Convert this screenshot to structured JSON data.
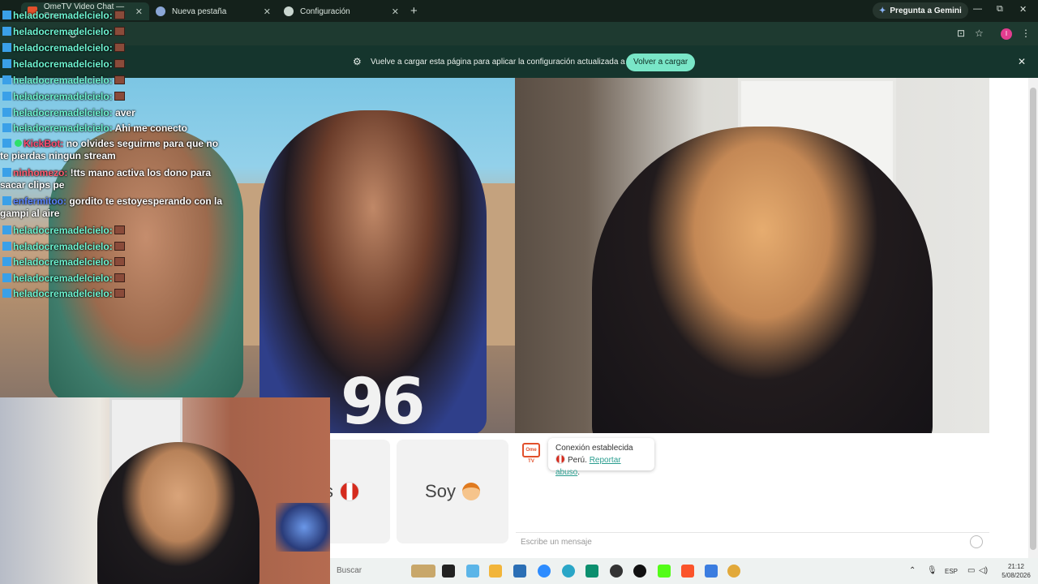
{
  "browser": {
    "tabs": [
      {
        "label": "OmeTV Video Chat — Ome",
        "active": true
      },
      {
        "label": "Nueva pestaña",
        "active": false
      },
      {
        "label": "Configuración",
        "active": false
      }
    ],
    "new_tab_glyph": "+",
    "gemini_label": "Pregunta a Gemini",
    "window_controls": {
      "minimize": "—",
      "restore": "⧉",
      "close": "✕"
    },
    "address_glyph": "⊙"
  },
  "infobar": {
    "message": "Vuelve a cargar esta página para aplicar la configuración actualizada a este sitio",
    "reload_label": "Volver a cargar",
    "close_glyph": "✕"
  },
  "buttons": {
    "country_suffix": "s",
    "soy_label": "Soy"
  },
  "chat": {
    "logo_text": "Ome TV",
    "connection_title": "Conexión establecida",
    "country": "Perú.",
    "report_link": "Reportar abuso",
    "report_suffix": ".",
    "input_placeholder": "Escribe un mensaje"
  },
  "stream_overlay": {
    "lines": [
      {
        "user": "heladocremadelcielo:",
        "text": "",
        "color": "#6ef5d2"
      },
      {
        "user": "heladocremadelcielo:",
        "text": "",
        "color": "#6ef5d2"
      },
      {
        "user": "heladocremadelcielo:",
        "text": "",
        "color": "#6ef5d2"
      },
      {
        "user": "heladocremadelcielo:",
        "text": "",
        "color": "#6ef5d2"
      },
      {
        "user": "heladocremadelcielo:",
        "text": "",
        "color": "#6ef5d2"
      },
      {
        "user": "heladocremadelcielo:",
        "text": "",
        "color": "#6ef5d2"
      },
      {
        "user": "heladocremadelcielo:",
        "text": "aver",
        "color": "#6ef5d2"
      },
      {
        "user": "heladocremadelcielo:",
        "text": "Ahi me conecto",
        "color": "#6ef5d2"
      },
      {
        "user": "KickBot:",
        "text": "no olvides seguirme para que no te pierdas ningun stream",
        "color": "#ff4b70"
      },
      {
        "user": "ninhomezo:",
        "text": "!tts mano activa los dono para sacar clips pe",
        "color": "#ff5b6e"
      },
      {
        "user": "enfermitoo:",
        "text": "gordito te estoyesperando con la gampi al aire",
        "color": "#5a84ff"
      },
      {
        "user": "heladocremadelcielo:",
        "text": "",
        "color": "#6ef5d2"
      },
      {
        "user": "heladocremadelcielo:",
        "text": "",
        "color": "#6ef5d2"
      },
      {
        "user": "heladocremadelcielo:",
        "text": "",
        "color": "#6ef5d2"
      },
      {
        "user": "heladocremadelcielo:",
        "text": "",
        "color": "#6ef5d2"
      },
      {
        "user": "heladocremadelcielo:",
        "text": "",
        "color": "#6ef5d2"
      }
    ]
  },
  "video": {
    "shirt_text": "96"
  },
  "taskbar": {
    "search_placeholder": "Buscar",
    "language": "ESP",
    "time": "21:12",
    "date": "5/08/2026"
  },
  "colors": {
    "accent_reload": "#79e6c7",
    "browser_dark": "#14211b",
    "ometv_red": "#e2502b",
    "link": "#2a9d8f"
  }
}
